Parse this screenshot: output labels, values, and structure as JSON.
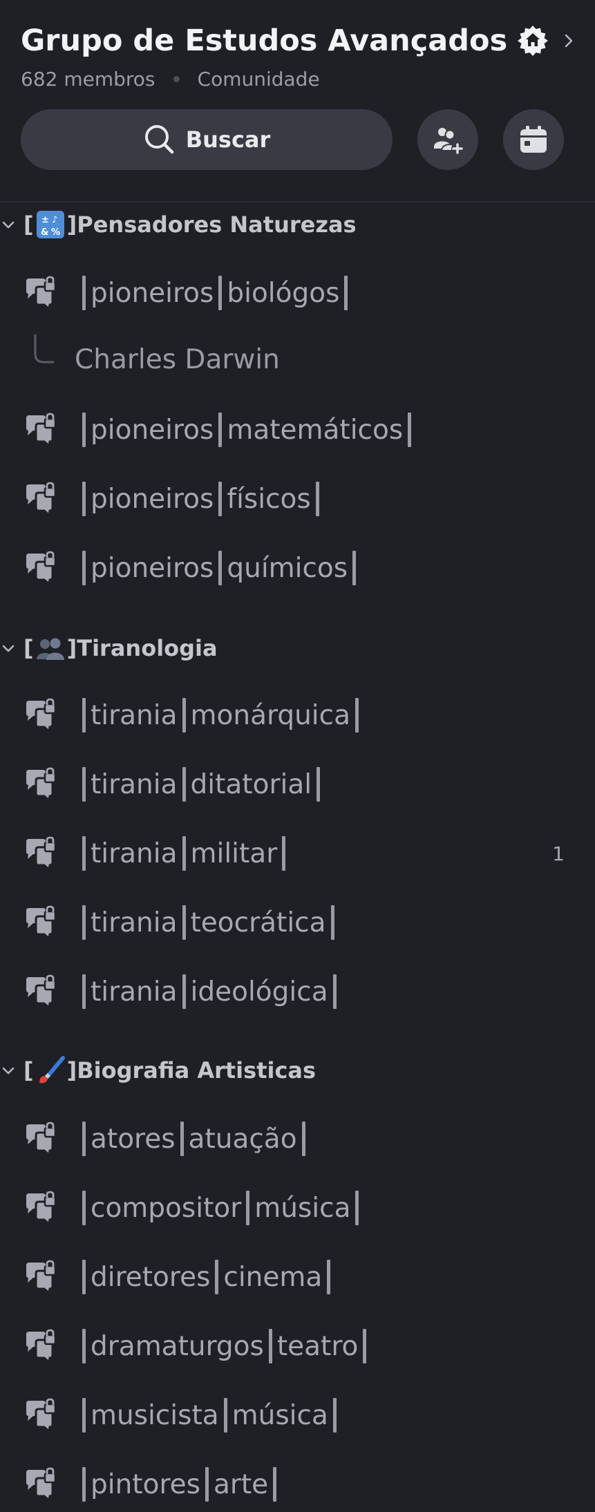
{
  "header": {
    "server_name": "Grupo de Estudos Avançados",
    "members": "682 membros",
    "type": "Comunidade",
    "search_label": "Buscar"
  },
  "icons": {
    "home": "home-badge-icon",
    "chevron": "chevron-right-icon",
    "search": "search-icon",
    "invite": "add-member-icon",
    "events": "calendar-icon",
    "channel": "locked-forum-icon"
  },
  "colors": {
    "background": "#1f2026",
    "button": "#393a43",
    "text_muted": "#a7a9b2",
    "category_text": "#c4c6cc"
  },
  "categories": [
    {
      "pre": "[",
      "emoji": "symbols-icon",
      "post": "]Pensadores Naturezas",
      "channels": [
        {
          "parts": [
            "pioneiros",
            "biológos"
          ],
          "thread": "Charles Darwin"
        },
        {
          "parts": [
            "pioneiros",
            "matemáticos"
          ]
        },
        {
          "parts": [
            "pioneiros",
            "físicos"
          ]
        },
        {
          "parts": [
            "pioneiros",
            "químicos"
          ]
        }
      ]
    },
    {
      "pre": "[",
      "emoji": "people-icon",
      "post": "]Tiranologia",
      "channels": [
        {
          "parts": [
            "tirania",
            "monárquica"
          ]
        },
        {
          "parts": [
            "tirania",
            "ditatorial"
          ]
        },
        {
          "parts": [
            "tirania",
            "militar"
          ],
          "badge": "1"
        },
        {
          "parts": [
            "tirania",
            "teocrática"
          ]
        },
        {
          "parts": [
            "tirania",
            "ideológica"
          ]
        }
      ]
    },
    {
      "pre": "[",
      "emoji": "paintbrush-icon",
      "post": "]Biografia Artisticas",
      "channels": [
        {
          "parts": [
            "atores",
            "atuação"
          ]
        },
        {
          "parts": [
            "compositor",
            "música"
          ]
        },
        {
          "parts": [
            "diretores",
            "cinema"
          ]
        },
        {
          "parts": [
            "dramaturgos",
            "teatro"
          ]
        },
        {
          "parts": [
            "musicista",
            "música"
          ]
        },
        {
          "parts": [
            "pintores",
            "arte"
          ]
        }
      ]
    }
  ]
}
